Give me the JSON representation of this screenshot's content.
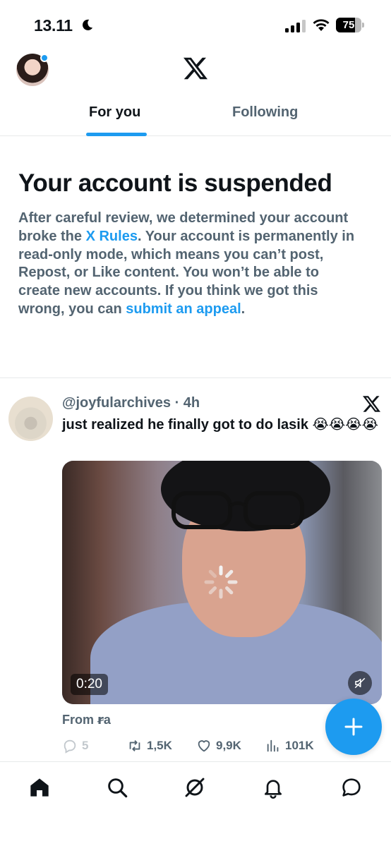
{
  "status_bar": {
    "time": "13.11",
    "battery": "75",
    "battery_level": 0.75
  },
  "header": {
    "logo": "X"
  },
  "tabs": [
    {
      "label": "For you",
      "active": true
    },
    {
      "label": "Following",
      "active": false
    }
  ],
  "notice": {
    "title": "Your account is suspended",
    "body_1": "After careful review, we determined your account broke the ",
    "rules_link": "X Rules",
    "body_2": ". Your account is permanently in read-only mode, which means you can’t post, Repost, or Like content. You won’t be able to create new accounts. If you think we got this wrong, you can ",
    "appeal_link": "submit an appeal",
    "body_3": "."
  },
  "tweet": {
    "handle": "@joyfularchives",
    "time": "4h",
    "text": "just realized he finally got to do lasik 😭😭😭😭",
    "video_duration": "0:20",
    "from": "From ꞧa",
    "replies": "5",
    "reposts": "1,5K",
    "likes": "9,9K",
    "views": "101K"
  },
  "colors": {
    "accent": "#1d9bf0",
    "text_primary": "#0f1419",
    "text_secondary": "#536471"
  },
  "icons": {
    "nav": [
      "home-icon",
      "search-icon",
      "grok-icon",
      "bell-icon",
      "messages-icon"
    ]
  }
}
